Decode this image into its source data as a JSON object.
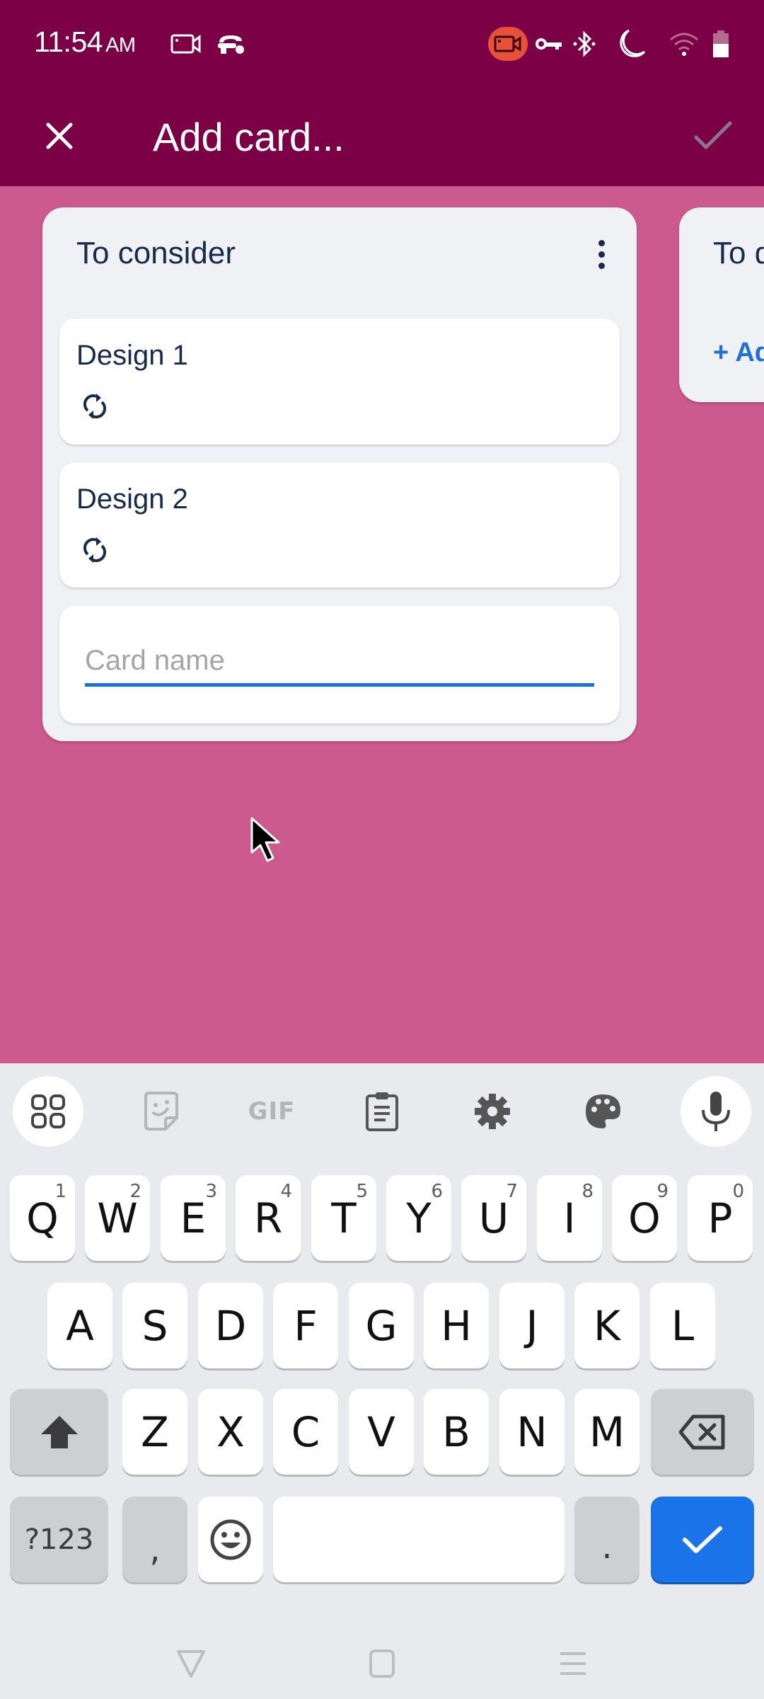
{
  "status_bar": {
    "time": "11:54",
    "ampm": "AM",
    "left_icons": [
      "screen-record-icon",
      "incognito-icon"
    ],
    "right_icons": [
      "recording-active-icon",
      "vpn-key-icon",
      "bluetooth-icon",
      "do-not-disturb-moon-icon",
      "wifi-icon",
      "battery-icon"
    ],
    "recording_badge_color": "#E8503A"
  },
  "app_bar": {
    "title": "Add card...",
    "close_icon": "close-icon",
    "confirm_icon": "check-icon",
    "background": "#7B0046"
  },
  "board": {
    "background": "#CC5A8E",
    "lists": [
      {
        "title": "To consider",
        "menu_icon": "more-vert-icon",
        "cards": [
          {
            "title": "Design 1",
            "badge_icon": "recurring-icon"
          },
          {
            "title": "Design 2",
            "badge_icon": "recurring-icon"
          }
        ],
        "new_card_input": {
          "value": "",
          "placeholder": "Card name"
        }
      },
      {
        "title": "To do",
        "title_visible": "To c",
        "add_label": "+ Add card",
        "add_label_visible": "+ A"
      }
    ]
  },
  "keyboard": {
    "toolbar": [
      "apps-grid-icon",
      "sticker-icon",
      "GIF",
      "clipboard-icon",
      "settings-icon",
      "palette-icon",
      "microphone-icon"
    ],
    "gif_label": "GIF",
    "row1": [
      {
        "key": "Q",
        "alt": "1"
      },
      {
        "key": "W",
        "alt": "2"
      },
      {
        "key": "E",
        "alt": "3"
      },
      {
        "key": "R",
        "alt": "4"
      },
      {
        "key": "T",
        "alt": "5"
      },
      {
        "key": "Y",
        "alt": "6"
      },
      {
        "key": "U",
        "alt": "7"
      },
      {
        "key": "I",
        "alt": "8"
      },
      {
        "key": "O",
        "alt": "9"
      },
      {
        "key": "P",
        "alt": "0"
      }
    ],
    "row2": [
      "A",
      "S",
      "D",
      "F",
      "G",
      "H",
      "J",
      "K",
      "L"
    ],
    "row3": [
      "Z",
      "X",
      "C",
      "V",
      "B",
      "N",
      "M"
    ],
    "symbols_label": "?123",
    "comma_label": ",",
    "period_label": ".",
    "enter_color": "#1A73E8"
  },
  "nav_bar": {
    "buttons": [
      "back-icon",
      "home-icon",
      "recents-icon"
    ]
  }
}
